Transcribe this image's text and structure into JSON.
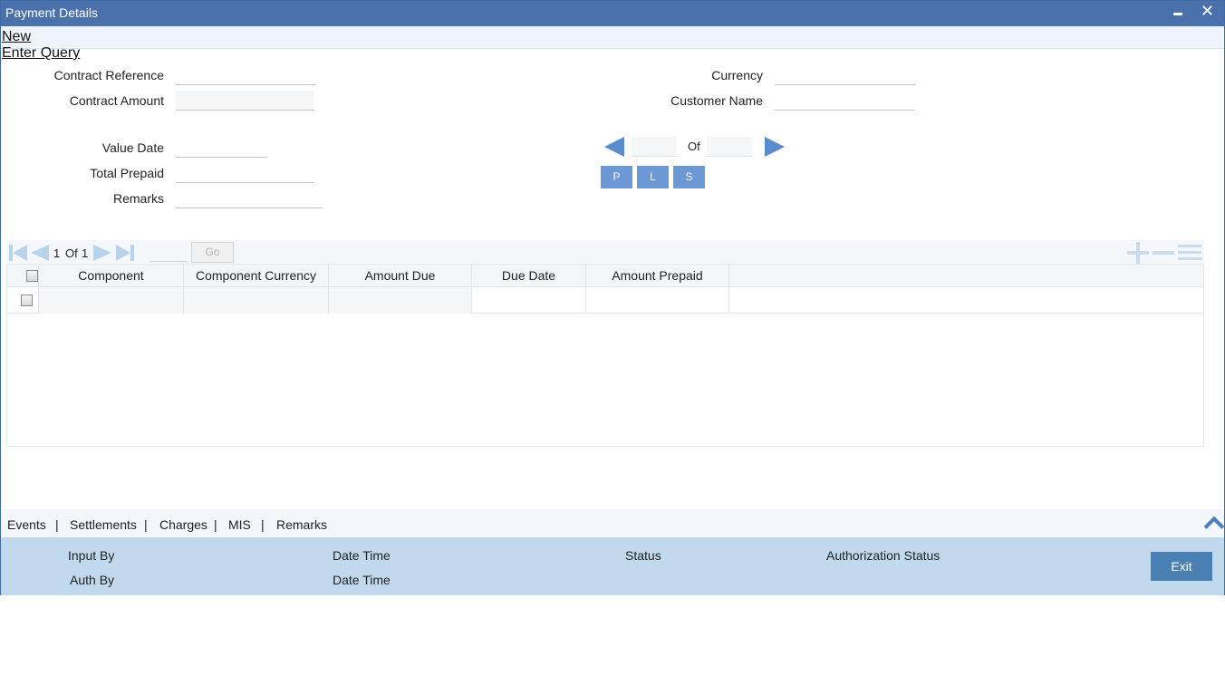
{
  "window": {
    "title": "Payment Details"
  },
  "toolbar": {
    "new_label": "New",
    "enter_query_label": "Enter Query"
  },
  "form": {
    "contract_reference_label": "Contract Reference",
    "contract_amount_label": "Contract Amount",
    "currency_label": "Currency",
    "customer_name_label": "Customer Name",
    "value_date_label": "Value Date",
    "total_prepaid_label": "Total Prepaid",
    "remarks_label": "Remarks",
    "contract_reference_value": "",
    "contract_amount_value": "",
    "currency_value": "",
    "customer_name_value": "",
    "value_date_value": "",
    "total_prepaid_value": "",
    "remarks_value": ""
  },
  "navigator": {
    "of_label": "Of",
    "current_value": "",
    "total_value": "",
    "buttons": {
      "p": "P",
      "l": "L",
      "s": "S"
    }
  },
  "grid": {
    "page_current": "1",
    "page_of": "Of",
    "page_total": "1",
    "go_label": "Go",
    "columns": {
      "component": "Component",
      "component_currency": "Component Currency",
      "amount_due": "Amount Due",
      "due_date": "Due Date",
      "amount_prepaid": "Amount Prepaid"
    },
    "rows": [
      {
        "component": "",
        "component_currency": "",
        "amount_due": "",
        "due_date": "",
        "amount_prepaid": ""
      }
    ]
  },
  "footer_tabs": {
    "events": "Events",
    "settlements": "Settlements",
    "charges": "Charges",
    "mis": "MIS",
    "remarks": "Remarks",
    "separator": "|"
  },
  "audit": {
    "input_by": "Input By",
    "auth_by": "Auth By",
    "date_time_1": "Date Time",
    "date_time_2": "Date Time",
    "status": "Status",
    "authorization_status": "Authorization Status",
    "exit_label": "Exit"
  },
  "colors": {
    "titlebar": "#4a71ab",
    "audit_bar": "#c0d9ec",
    "exit_button": "#4a7fb3",
    "nav_button": "#6c98d6"
  }
}
